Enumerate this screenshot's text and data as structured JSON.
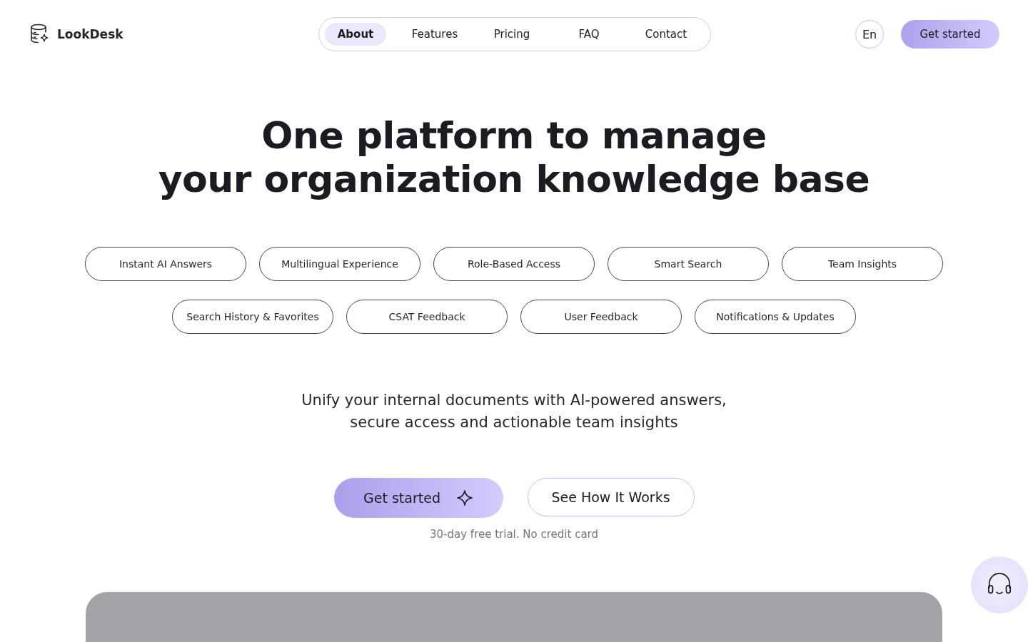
{
  "brand": {
    "name": "LookDesk"
  },
  "nav": [
    {
      "label": "About",
      "selected": true
    },
    {
      "label": "Features",
      "selected": false
    },
    {
      "label": "Pricing",
      "selected": false
    },
    {
      "label": "FAQ",
      "selected": false
    },
    {
      "label": "Contact",
      "selected": false
    }
  ],
  "language": "En",
  "header_cta": "Get started",
  "headline": [
    "One platform to manage",
    "your organization knowledge base"
  ],
  "feature_rows": [
    [
      "Instant AI Answers",
      "Multilingual Experience",
      "Role-Based Access",
      "Smart Search",
      "Team Insights"
    ],
    [
      "Search History & Favorites",
      "CSAT Feedback",
      "User Feedback",
      "Notifications & Updates"
    ]
  ],
  "subtitle": [
    "Unify your internal documents with AI-powered answers,",
    "secure access and actionable team insights"
  ],
  "primary_cta": "Get started",
  "secondary_cta": "See How It Works",
  "note": "30-day free trial. No credit card"
}
